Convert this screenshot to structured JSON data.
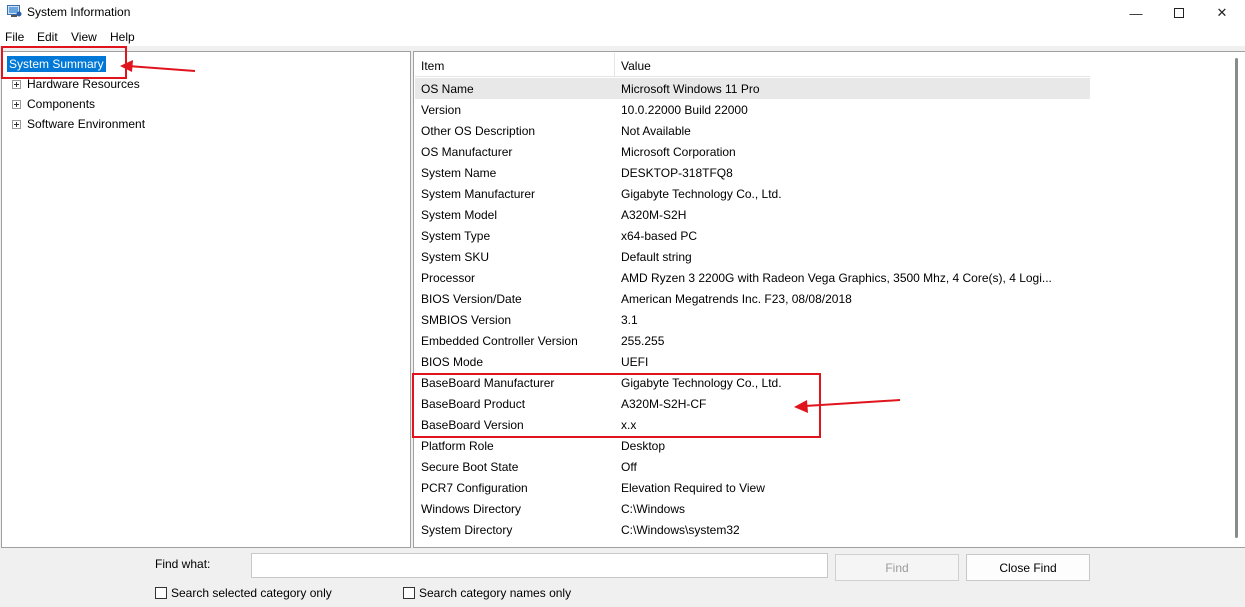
{
  "window": {
    "title": "System Information",
    "controls": {
      "minimize": "—",
      "close": "✕"
    }
  },
  "menu": [
    {
      "label": "File"
    },
    {
      "label": "Edit"
    },
    {
      "label": "View"
    },
    {
      "label": "Help"
    }
  ],
  "tree": {
    "selected": "System Summary",
    "children": [
      {
        "label": "Hardware Resources"
      },
      {
        "label": "Components"
      },
      {
        "label": "Software Environment"
      }
    ]
  },
  "list": {
    "columns": {
      "item": "Item",
      "value": "Value"
    },
    "rows": [
      {
        "item": "OS Name",
        "value": "Microsoft Windows 11 Pro"
      },
      {
        "item": "Version",
        "value": "10.0.22000 Build 22000"
      },
      {
        "item": "Other OS Description",
        "value": "Not Available"
      },
      {
        "item": "OS Manufacturer",
        "value": "Microsoft Corporation"
      },
      {
        "item": "System Name",
        "value": "DESKTOP-318TFQ8"
      },
      {
        "item": "System Manufacturer",
        "value": "Gigabyte Technology Co., Ltd."
      },
      {
        "item": "System Model",
        "value": "A320M-S2H"
      },
      {
        "item": "System Type",
        "value": "x64-based PC"
      },
      {
        "item": "System SKU",
        "value": "Default string"
      },
      {
        "item": "Processor",
        "value": "AMD Ryzen 3 2200G with Radeon Vega Graphics, 3500 Mhz, 4 Core(s), 4 Logi..."
      },
      {
        "item": "BIOS Version/Date",
        "value": "American Megatrends Inc. F23, 08/08/2018"
      },
      {
        "item": "SMBIOS Version",
        "value": "3.1"
      },
      {
        "item": "Embedded Controller Version",
        "value": "255.255"
      },
      {
        "item": "BIOS Mode",
        "value": "UEFI"
      },
      {
        "item": "BaseBoard Manufacturer",
        "value": "Gigabyte Technology Co., Ltd."
      },
      {
        "item": "BaseBoard Product",
        "value": "A320M-S2H-CF"
      },
      {
        "item": "BaseBoard Version",
        "value": "x.x"
      },
      {
        "item": "Platform Role",
        "value": "Desktop"
      },
      {
        "item": "Secure Boot State",
        "value": "Off"
      },
      {
        "item": "PCR7 Configuration",
        "value": "Elevation Required to View"
      },
      {
        "item": "Windows Directory",
        "value": "C:\\Windows"
      },
      {
        "item": "System Directory",
        "value": "C:\\Windows\\system32"
      }
    ]
  },
  "find": {
    "label": "Find what:",
    "value": "",
    "find_button": "Find",
    "close_button": "Close Find",
    "check_selected": "Search selected category only",
    "check_names": "Search category names only"
  },
  "colors": {
    "selection": "#0078d7",
    "annotation": "#e0141c"
  }
}
